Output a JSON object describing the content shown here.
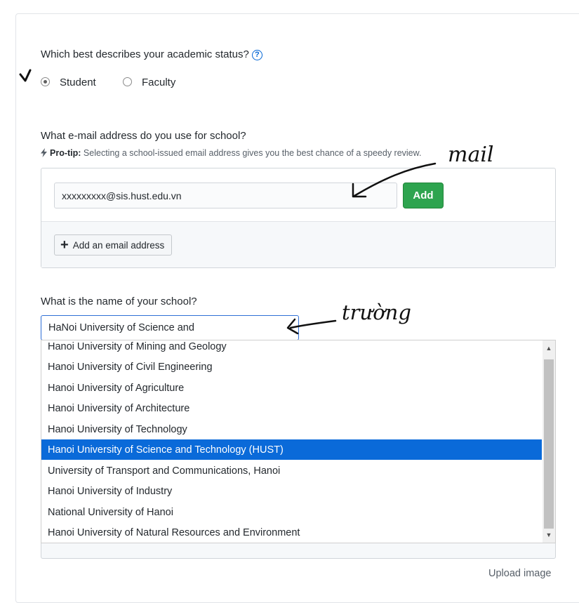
{
  "status_question": {
    "label": "Which best describes your academic status?",
    "help_icon": "question-circle-icon"
  },
  "status_options": [
    {
      "label": "Student",
      "checked": true
    },
    {
      "label": "Faculty",
      "checked": false
    }
  ],
  "email_section": {
    "question": "What e-mail address do you use for school?",
    "protip_prefix": "Pro-tip:",
    "protip_text": "Selecting a school-issued email address gives you the best chance of a speedy review.",
    "protip_icon": "lightning-bolt-icon",
    "input_value": "xxxxxxxxx@sis.hust.edu.vn",
    "add_button": "Add",
    "add_email_button": "Add an email address"
  },
  "school_section": {
    "question": "What is the name of your school?",
    "input_value": "HaNoi University of Science and",
    "options": [
      "Hanoi University of Mining and Geology",
      "Hanoi University of Civil Engineering",
      "Hanoi University of Agriculture",
      "Hanoi University of Architecture",
      "Hanoi University of Technology",
      "Hanoi University of Science and Technology (HUST)",
      "University of Transport and Communications, Hanoi",
      "Hanoi University of Industry",
      "National University of Hanoi",
      "Hanoi University of Natural Resources and Environment"
    ],
    "selected_option": "Hanoi University of Science and Technology (HUST)"
  },
  "upload_link": "Upload image",
  "annotations": {
    "mail": "mail",
    "school": "trường"
  },
  "colors": {
    "accent": "#0366d6",
    "add_button": "#2ea44f",
    "selected_option": "#0a6ad9"
  }
}
